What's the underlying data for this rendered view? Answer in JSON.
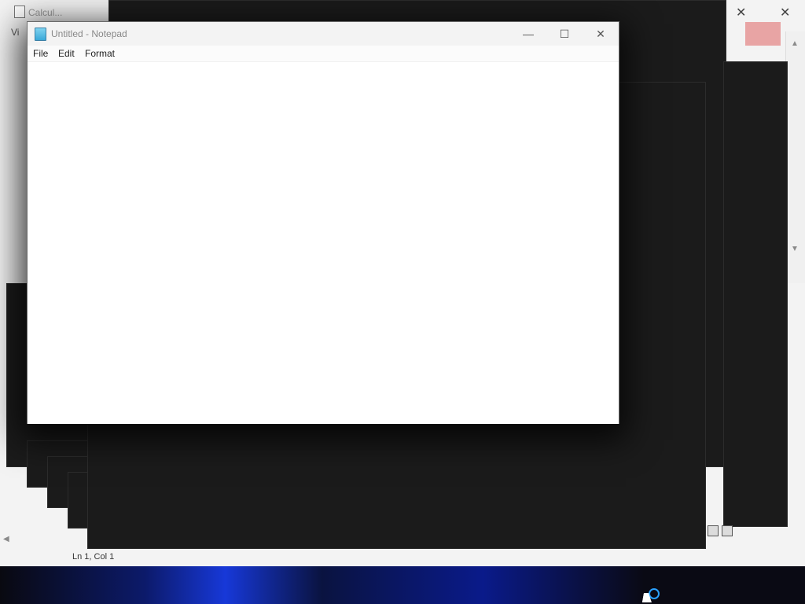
{
  "notepad": {
    "title": "Untitled - Notepad",
    "menu": {
      "file": "File",
      "edit": "Edit",
      "format": "Format"
    },
    "controls": {
      "minimize_glyph": "—",
      "maximize_glyph": "☐",
      "close_glyph": "✕"
    },
    "content": ""
  },
  "background_windows": {
    "calculator_title": "Calcul...",
    "menu_partial": "Vi",
    "status": "Ln 1, Col 1",
    "close_glyph": "✕"
  },
  "colors": {
    "notepad_icon": "#3aa8d8",
    "loader": "#2aa0ff",
    "close_hover": "#e8a4a4"
  }
}
